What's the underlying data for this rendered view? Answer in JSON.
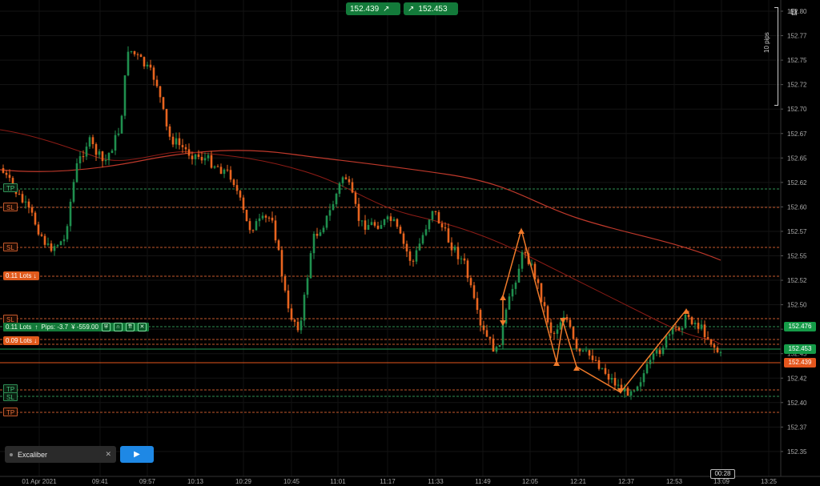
{
  "quotes": {
    "bid": "152.439",
    "ask": "152.453",
    "bid_icon": "arrow-up-right-icon",
    "ask_icon": "arrow-up-right-icon"
  },
  "scale": {
    "pips_label": "10 pips"
  },
  "y_axis": {
    "labels": [
      "152.80",
      "152.77",
      "152.75",
      "152.72",
      "152.70",
      "152.67",
      "152.65",
      "152.62",
      "152.60",
      "152.57",
      "152.55",
      "152.52",
      "152.50",
      "152.47",
      "152.45",
      "152.42",
      "152.40",
      "152.37",
      "152.35"
    ]
  },
  "x_axis": {
    "labels": [
      "01 Apr 2021",
      "09:41",
      "09:57",
      "10:13",
      "10:29",
      "10:45",
      "11:01",
      "11:17",
      "11:33",
      "11:49",
      "12:05",
      "12:21",
      "12:37",
      "12:53",
      "13:09",
      "13:25"
    ]
  },
  "price_labels": {
    "green1": "152.476",
    "green2": "152.453",
    "red": "152.439"
  },
  "order_tags": {
    "tp1": "TP",
    "sl1": "SL",
    "sl2": "SL",
    "lots1": "0.11 Lots",
    "sl3": "SL",
    "lots2": "0.09 Lots",
    "tp2": "TP",
    "sl4": "SL",
    "tp3": "TP"
  },
  "position": {
    "lots": "0.11 Lots",
    "pips": "Pips: -3.7",
    "pnl": "¥ -559.00"
  },
  "algo": {
    "name": "Excaliber",
    "clear": "✕"
  },
  "timer": "00:28",
  "colors": {
    "bull": "#1f8f4e",
    "bear": "#e8641f",
    "ma_slow": "#c0392b",
    "ma_fast": "#8e1c16"
  }
}
